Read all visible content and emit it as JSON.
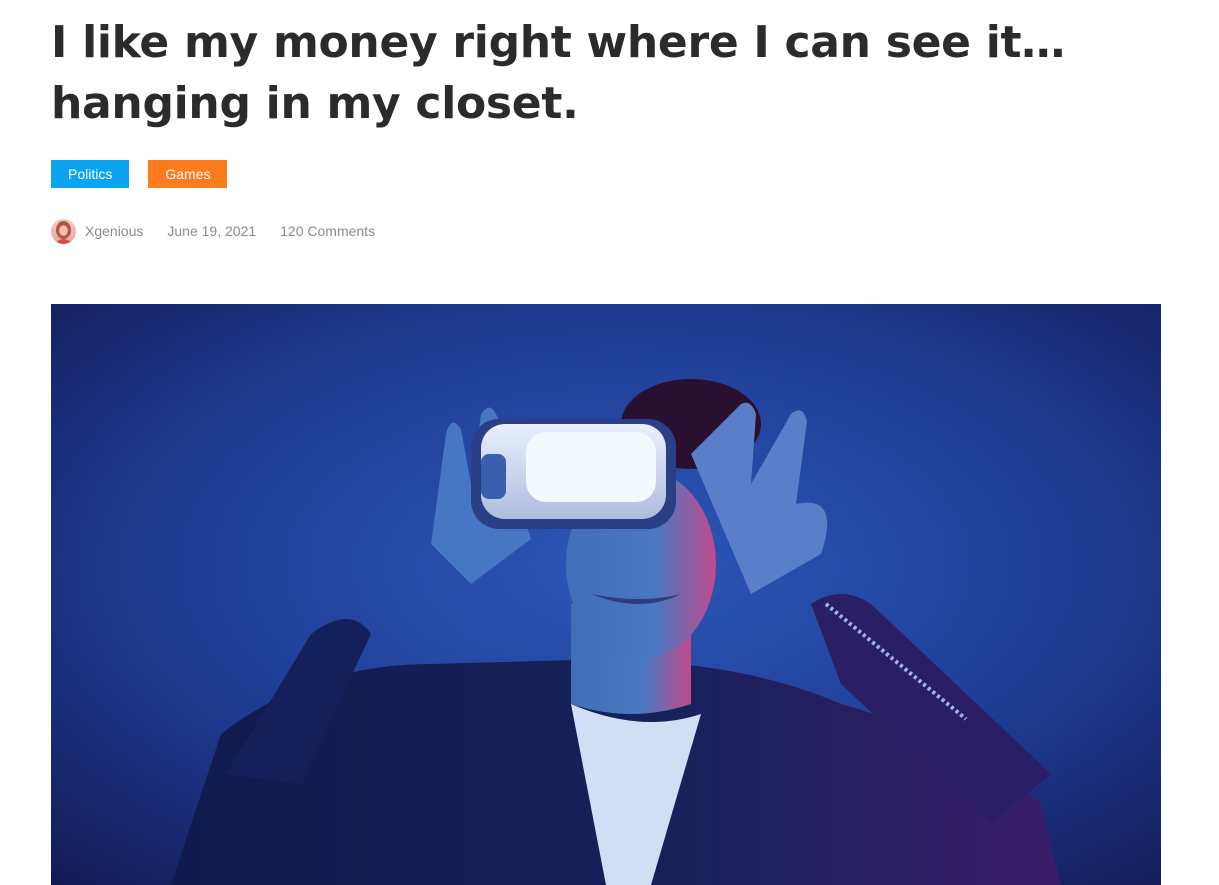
{
  "post": {
    "title": "I like my money right where I can see it…hanging in my closet.",
    "categories": [
      {
        "label": "Politics",
        "color": "#0ca4f0"
      },
      {
        "label": "Games",
        "color": "#fc7b1e"
      }
    ],
    "author": "Xgenious",
    "date": "June 19, 2021",
    "comments": "120 Comments"
  },
  "icons": {
    "author_avatar": "avatar-icon"
  }
}
